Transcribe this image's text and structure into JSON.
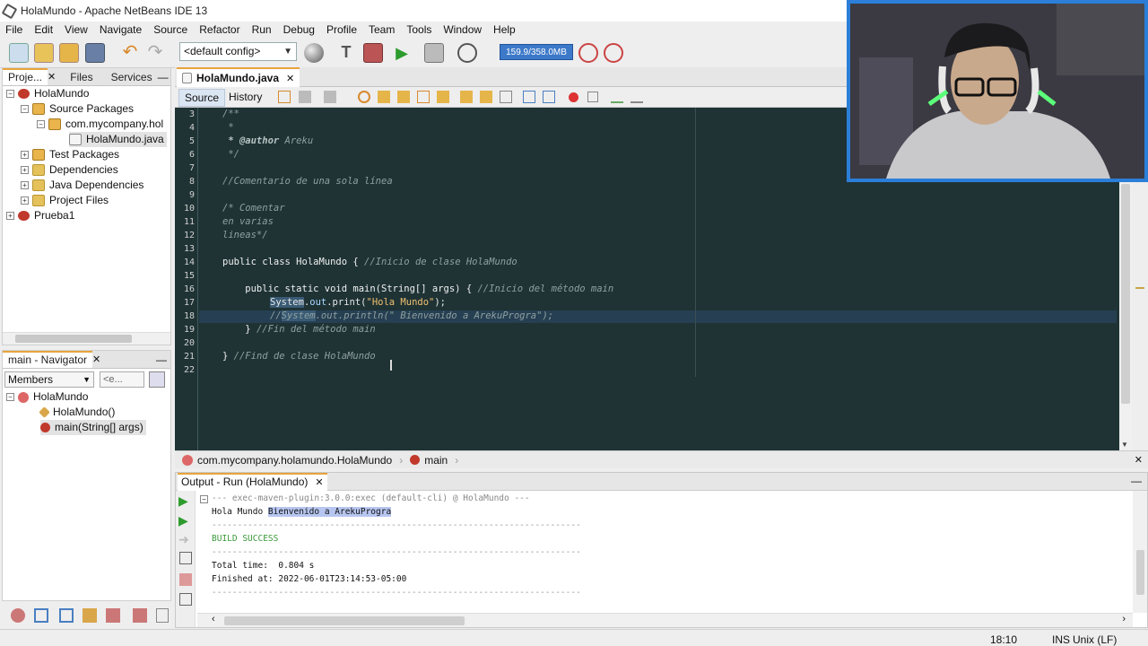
{
  "window": {
    "title": "HolaMundo - Apache NetBeans IDE 13"
  },
  "menu": [
    "File",
    "Edit",
    "View",
    "Navigate",
    "Source",
    "Refactor",
    "Run",
    "Debug",
    "Profile",
    "Team",
    "Tools",
    "Window",
    "Help"
  ],
  "toolbar": {
    "config": "<default config>",
    "memory": "159.9/358.0MB"
  },
  "projects_panel": {
    "tabs": [
      "Proje...",
      "Files",
      "Services"
    ],
    "tree": [
      {
        "label": "HolaMundo",
        "icon": "project-icon"
      },
      {
        "label": "Source Packages",
        "icon": "package-folder-icon"
      },
      {
        "label": "com.mycompany.hol",
        "icon": "package-icon"
      },
      {
        "label": "HolaMundo.java",
        "icon": "java-file-icon"
      },
      {
        "label": "Test Packages",
        "icon": "package-folder-icon"
      },
      {
        "label": "Dependencies",
        "icon": "folder-icon"
      },
      {
        "label": "Java Dependencies",
        "icon": "folder-icon"
      },
      {
        "label": "Project Files",
        "icon": "folder-icon"
      },
      {
        "label": "Prueba1",
        "icon": "project-icon"
      }
    ]
  },
  "navigator": {
    "title": "main - Navigator",
    "filter": "Members",
    "filter2": "<e...",
    "tree": [
      {
        "label": "HolaMundo"
      },
      {
        "label": "HolaMundo()"
      },
      {
        "label": "main(String[] args)"
      }
    ]
  },
  "editor": {
    "tab": "HolaMundo.java",
    "subtabs": [
      "Source",
      "History"
    ],
    "line_numbers": [
      "3",
      "4",
      "5",
      "6",
      "7",
      "8",
      "9",
      "10",
      "11",
      "12",
      "13",
      "14",
      "15",
      "16",
      "17",
      "18",
      "19",
      "20",
      "21",
      "22"
    ],
    "lines": {
      "l3": "/**",
      "l4": " *",
      "l5a": " * @author",
      "l5b": " Areku",
      "l6": " */",
      "l8": "//Comentario de una sola línea",
      "l10": "/* Comentar",
      "l11": "en varias",
      "l12": "lineas*/",
      "l14a": "public class HolaMundo { ",
      "l14b": "//Inicio de clase HolaMundo",
      "l16a": "    public static void main(String[] args) { ",
      "l16b": "//Inicio del método main",
      "l17a": "System",
      "l17b": ".",
      "l17c": "out",
      "l17d": ".print(",
      "l17e": "\"Hola Mundo\"",
      "l17f": ");",
      "l18a": "//",
      "l18b": "System",
      "l18c": ".out.println(\" Bienvenido a ArekuProgra\");",
      "l19a": "    } ",
      "l19b": "//Fin del método main",
      "l21a": "} ",
      "l21b": "//Find de clase HolaMundo"
    }
  },
  "breadcrumb": {
    "cls": "com.mycompany.holamundo.HolaMundo",
    "method": "main"
  },
  "output": {
    "title": "Output - Run (HolaMundo)",
    "lines": {
      "o1": "--- exec-maven-plugin:3.0.0:exec (default-cli) @ HolaMundo ---",
      "o2a": "Hola Mundo ",
      "o2b": "Bienvenido a ArekuProgra",
      "o3": "------------------------------------------------------------------------",
      "o4": "BUILD SUCCESS",
      "o5": "------------------------------------------------------------------------",
      "o6": "Total time:  0.804 s",
      "o7": "Finished at: 2022-06-01T23:14:53-05:00",
      "o8": "------------------------------------------------------------------------"
    }
  },
  "status": {
    "position": "18:10",
    "mode": "INS",
    "eol": "Unix (LF)"
  },
  "colors": {
    "editor_bg": "#1f3335",
    "accent": "#2b7fd8",
    "build_success": "#3a9a3a"
  }
}
